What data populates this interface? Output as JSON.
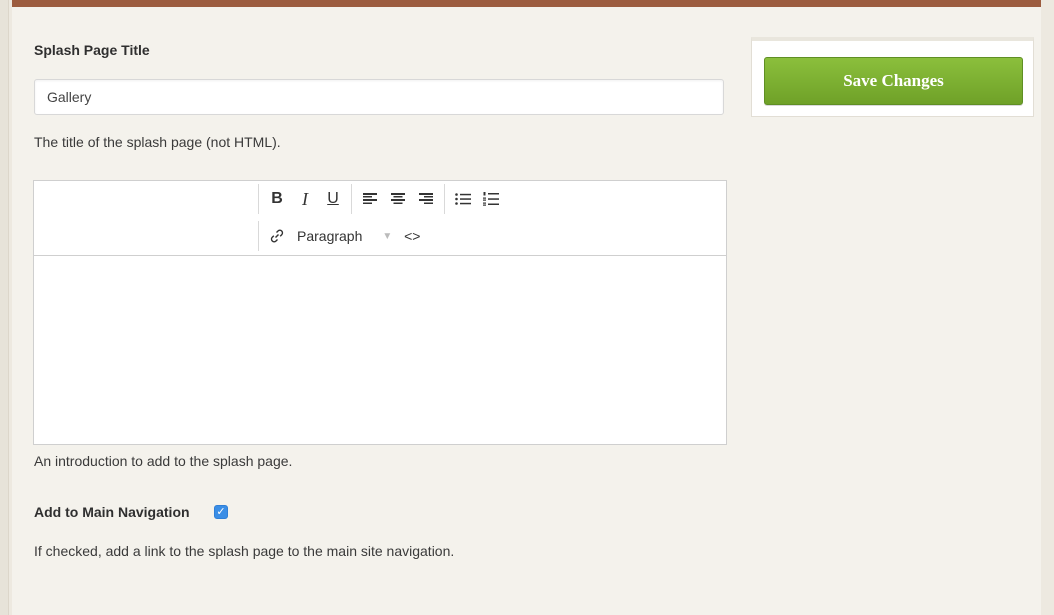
{
  "form": {
    "title_label": "Splash Page Title",
    "title_value": "Gallery",
    "title_help": "The title of the splash page (not HTML).",
    "intro_help": "An introduction to add to the splash page.",
    "nav_label": "Add to Main Navigation",
    "nav_checked": true,
    "nav_help": "If checked, add a link to the splash page to the main site navigation."
  },
  "editor": {
    "toolbar": {
      "bold": "B",
      "italic": "I",
      "underline": "U",
      "format_select": "Paragraph",
      "code": "<>"
    },
    "content": ""
  },
  "sidebar": {
    "save_label": "Save Changes"
  },
  "colors": {
    "top_bar": "#9c5c3f",
    "save_button": "#7aaf31",
    "checkbox": "#3a8ee6"
  }
}
